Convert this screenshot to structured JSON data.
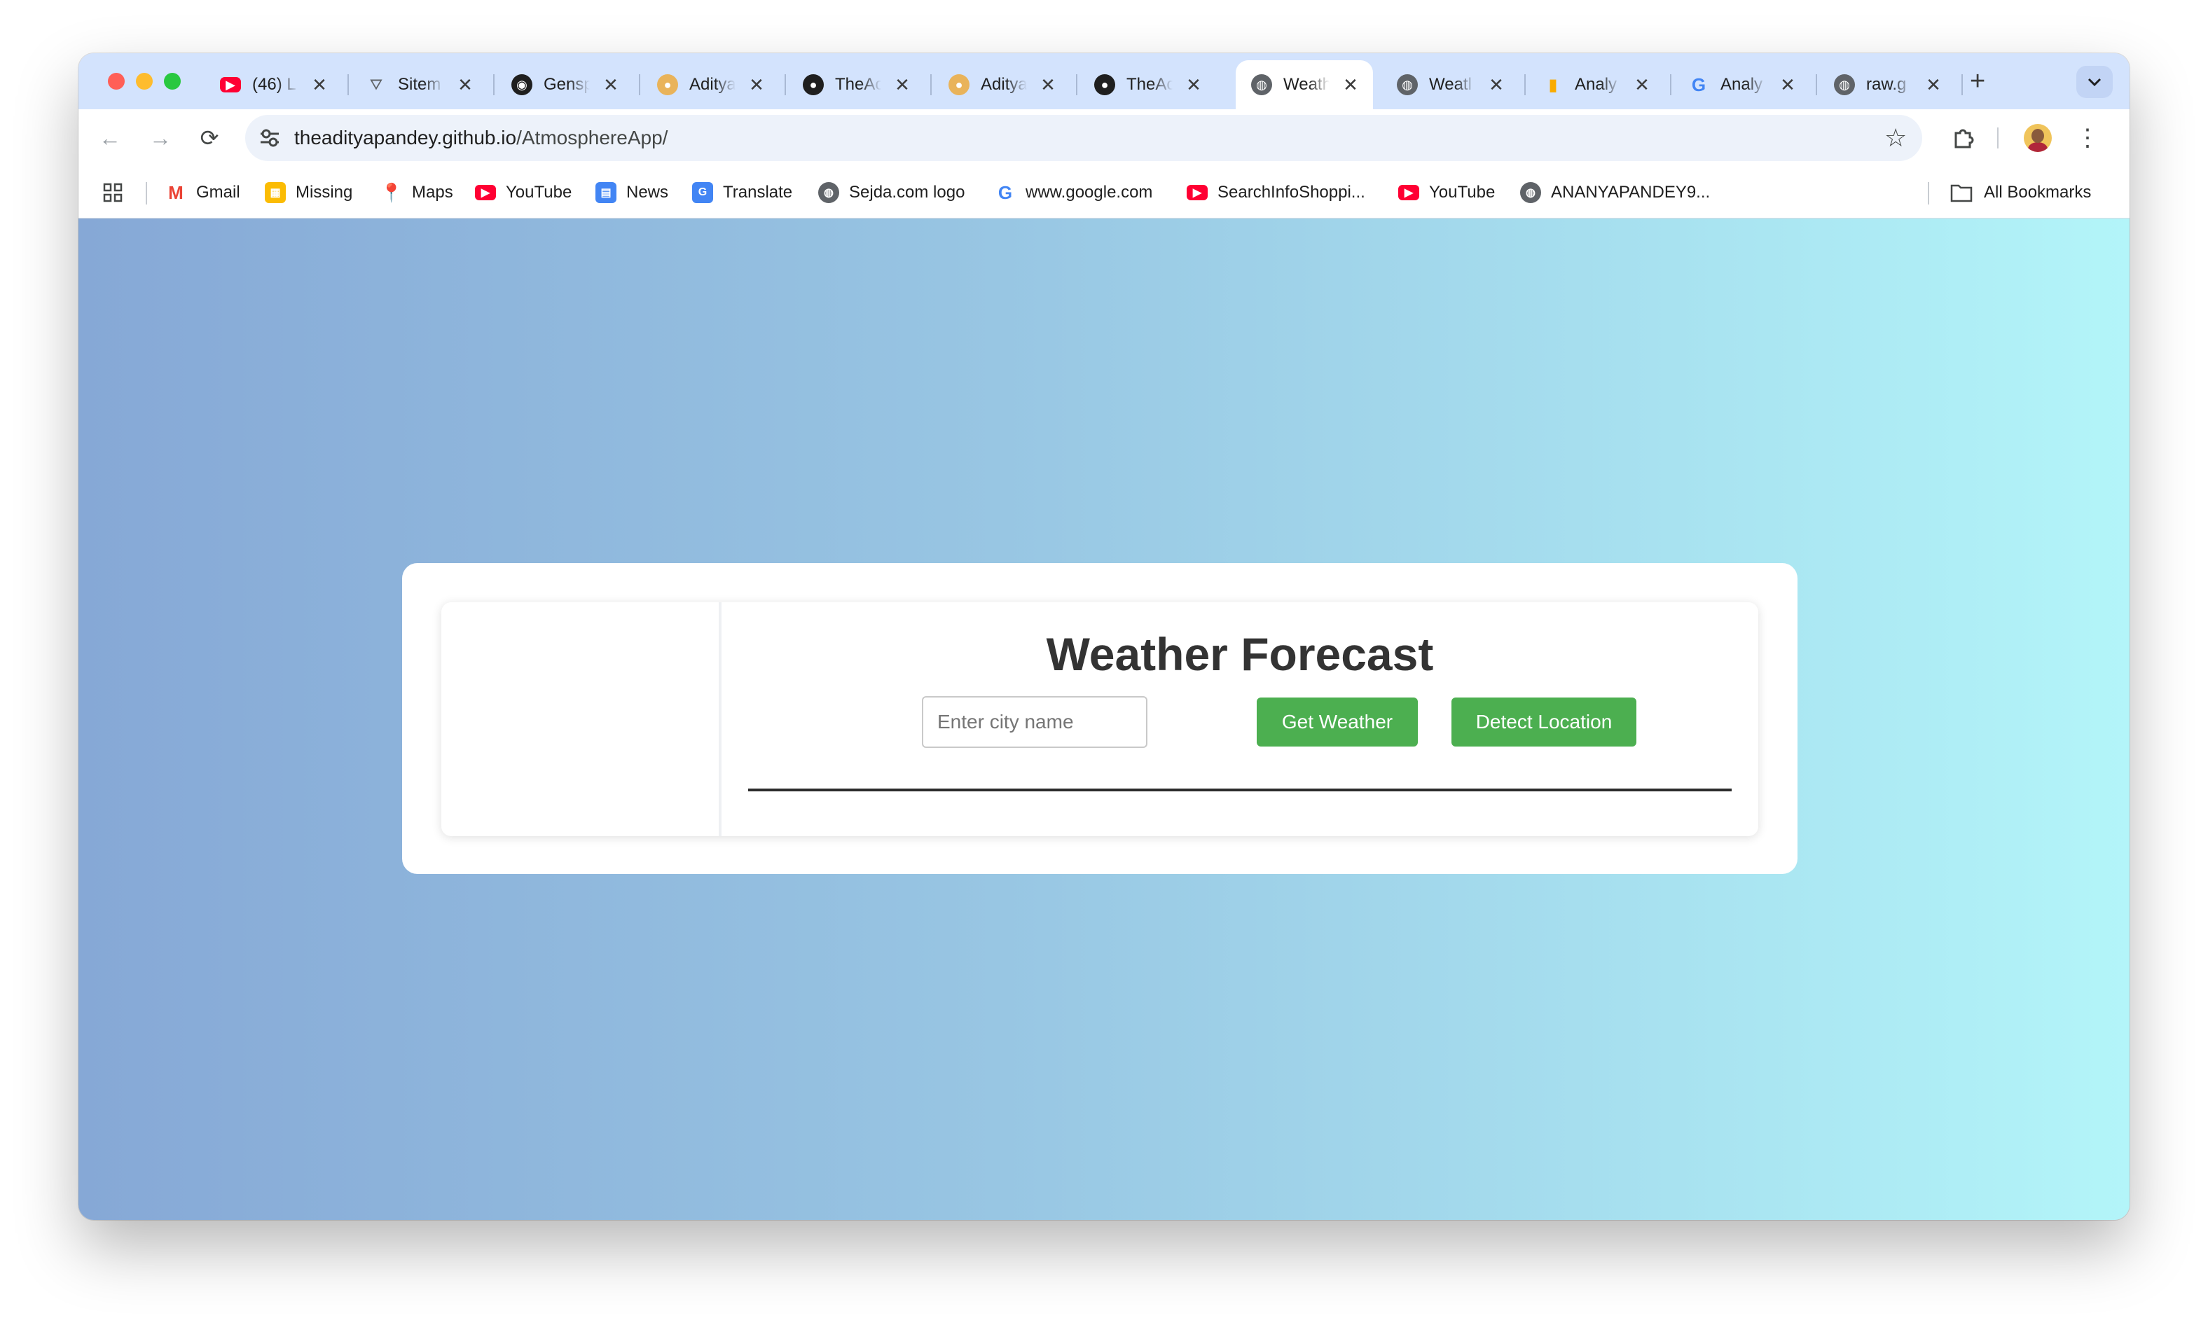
{
  "browser": {
    "tabs": [
      {
        "title": "(46) L",
        "icon": "youtube-icon",
        "active": false
      },
      {
        "title": "Sitem",
        "icon": "sitemap-icon",
        "active": false
      },
      {
        "title": "Gensp",
        "icon": "genspark-icon",
        "active": false
      },
      {
        "title": "Aditya",
        "icon": "avatar-icon",
        "active": false
      },
      {
        "title": "TheAc",
        "icon": "github-icon",
        "active": false
      },
      {
        "title": "Aditya",
        "icon": "avatar-icon",
        "active": false
      },
      {
        "title": "TheAc",
        "icon": "github-icon",
        "active": false
      },
      {
        "title": "Weath",
        "icon": "globe-icon",
        "active": true
      },
      {
        "title": "Weatl",
        "icon": "globe-icon",
        "active": false
      },
      {
        "title": "Analy",
        "icon": "analytics-icon",
        "active": false
      },
      {
        "title": "Analy",
        "icon": "google-icon",
        "active": false
      },
      {
        "title": "raw.g",
        "icon": "globe-icon",
        "active": false
      }
    ],
    "address": {
      "host": "theadityapandey.github.io",
      "path": "/AtmosphereApp/"
    },
    "bookmarks": [
      {
        "label": "Gmail",
        "icon": "gmail-icon"
      },
      {
        "label": "Missing",
        "icon": "missing-icon"
      },
      {
        "label": "Maps",
        "icon": "maps-icon"
      },
      {
        "label": "YouTube",
        "icon": "youtube-icon"
      },
      {
        "label": "News",
        "icon": "news-icon"
      },
      {
        "label": "Translate",
        "icon": "translate-icon"
      },
      {
        "label": "Sejda.com logo",
        "icon": "globe-icon"
      },
      {
        "label": "www.google.com",
        "icon": "google-icon"
      },
      {
        "label": "SearchInfoShoppi...",
        "icon": "youtube-icon"
      },
      {
        "label": "YouTube",
        "icon": "youtube-icon"
      },
      {
        "label": "ANANYAPANDEY9...",
        "icon": "globe-icon"
      }
    ],
    "all_bookmarks_label": "All Bookmarks"
  },
  "colors": {
    "tabstrip": "#d3e3fd",
    "accent_green": "#4caf50",
    "youtube_red": "#ff0033",
    "gradient_start": "#86a8d6",
    "gradient_end": "#b3f5f9"
  },
  "app": {
    "title": "Weather Forecast",
    "city_placeholder": "Enter city name",
    "city_value": "",
    "get_weather_label": "Get Weather",
    "detect_location_label": "Detect Location"
  }
}
